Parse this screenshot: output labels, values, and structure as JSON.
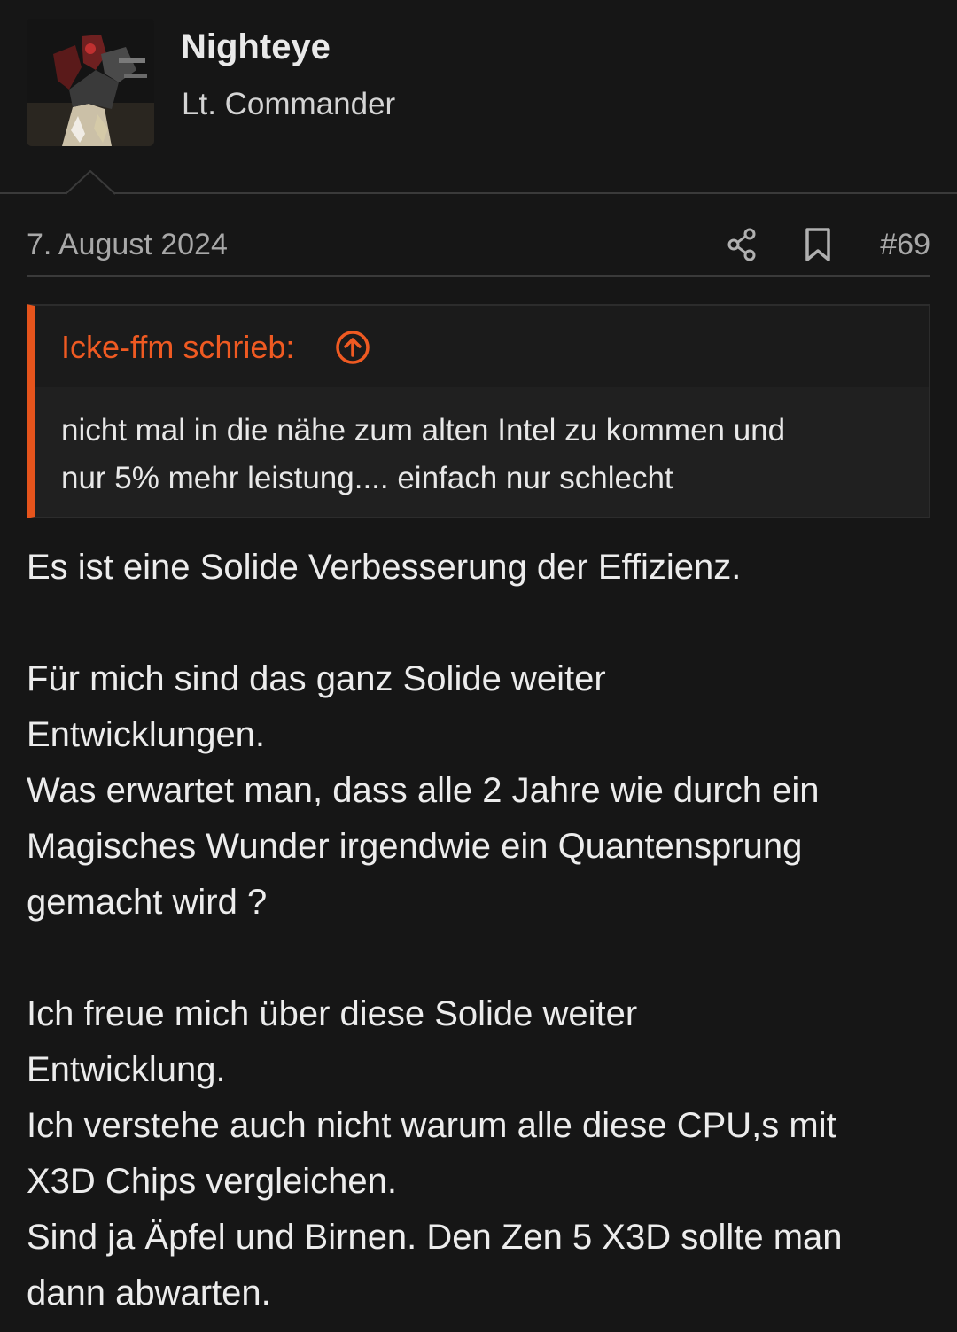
{
  "user": {
    "name": "Nighteye",
    "rank": "Lt. Commander",
    "avatar_icon": "robot-avatar"
  },
  "post": {
    "date": "7. August 2024",
    "number": "#69",
    "actions": [
      "share-icon",
      "bookmark-icon"
    ]
  },
  "quote": {
    "author": "Icke-ffm schrieb:",
    "lines": [
      "nicht mal in die nähe zum alten Intel zu kommen und",
      "nur 5% mehr leistung.... einfach nur schlecht"
    ]
  },
  "body": {
    "paragraphs": [
      [
        "Es ist eine Solide Verbesserung der Effizienz."
      ],
      [
        "Für mich sind das ganz Solide weiter",
        "Entwicklungen.",
        "Was erwartet man, dass alle 2 Jahre wie durch ein",
        "Magisches Wunder irgendwie ein Quantensprung",
        "gemacht wird ?"
      ],
      [
        "Ich freue mich über diese Solide weiter",
        "Entwicklung.",
        "Ich verstehe auch nicht warum alle diese CPU,s mit",
        "X3D Chips vergleichen.",
        "Sind ja Äpfel und Birnen. Den Zen 5 X3D sollte man",
        "dann abwarten."
      ]
    ]
  },
  "colors": {
    "background": "#161616",
    "accent": "#e6541c",
    "text": "#ececec",
    "muted": "#a8a8a8"
  }
}
